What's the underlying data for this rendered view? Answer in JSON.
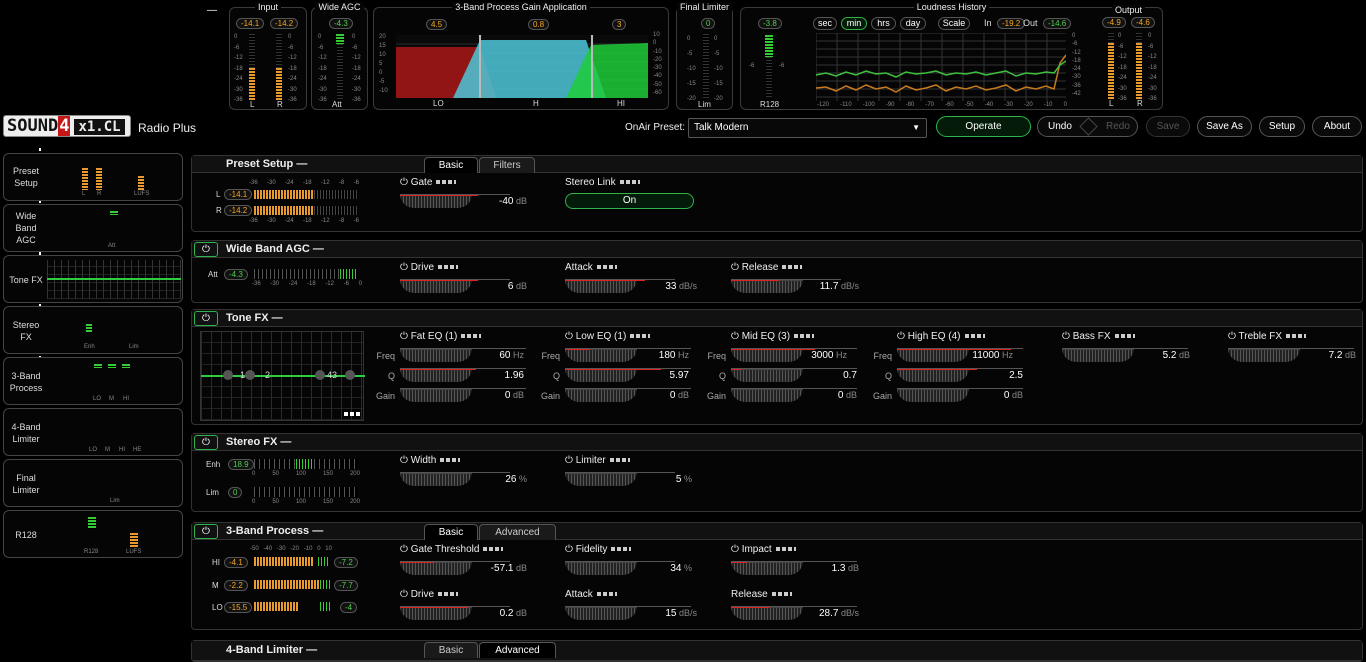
{
  "top": {
    "dash": "—",
    "input": {
      "title": "Input",
      "l": "-14.1",
      "r": "-14.2",
      "ticks": [
        "0",
        "-6",
        "-12",
        "-18",
        "-24",
        "-30",
        "-36"
      ],
      "l_label": "L",
      "r_label": "R"
    },
    "agc": {
      "title": "Wide AGC",
      "val": "-4.3",
      "ticks": [
        "0",
        "-6",
        "-12",
        "-18",
        "-24",
        "-30",
        "-36"
      ],
      "label": "Att"
    },
    "band3": {
      "title": "3-Band Process Gain Application",
      "v1": "4.5",
      "v2": "0.8",
      "v3": "3",
      "lo": "LO",
      "mid": "H",
      "hi": "HI",
      "lticks": [
        "20",
        "15",
        "10",
        "5",
        "0",
        "-5",
        "-10"
      ],
      "rticks": [
        "10",
        "0",
        "-10",
        "-20",
        "-30",
        "-40",
        "-50",
        "-60"
      ]
    },
    "final": {
      "title": "Final Limiter",
      "val": "0",
      "ticks": [
        "0",
        "-5",
        "-10",
        "-15",
        "-20"
      ],
      "label": "Lim"
    },
    "loudness": {
      "title": "Loudness History",
      "val": "-3.8",
      "btns": [
        "sec",
        "min",
        "hrs",
        "day"
      ],
      "scale": "Scale",
      "in_label": "In",
      "in_val": "-19.2",
      "out_label": "Out",
      "out_val": "-14.6",
      "lticks": [
        "0",
        "-6",
        "-12"
      ],
      "rticks": [
        "0",
        "-6",
        "-12",
        "-18",
        "-24",
        "-30",
        "-36",
        "-42"
      ],
      "xticks": [
        "-120",
        "-110",
        "-100",
        "-90",
        "-80",
        "-70",
        "-60",
        "-50",
        "-40",
        "-30",
        "-20",
        "-10",
        "0"
      ],
      "label": "R128",
      "left_top": "-6"
    },
    "output": {
      "title": "Output",
      "l": "-4.9",
      "r": "-4.6",
      "ticks": [
        "0",
        "-6",
        "-12",
        "-18",
        "-24",
        "-30",
        "-36"
      ],
      "l_label": "L",
      "r_label": "R"
    }
  },
  "brand": {
    "logo1": "SOUND",
    "logo2": "4",
    "logo3": "x1.CL",
    "product": "Radio Plus"
  },
  "toolbar": {
    "onair_label": "OnAir Preset:",
    "preset": "Talk Modern",
    "operate": "Operate",
    "undo": "Undo",
    "redo": "Redo",
    "save": "Save",
    "save_as": "Save As",
    "setup": "Setup",
    "about": "About"
  },
  "sidebar": [
    {
      "label": "Preset Setup",
      "sub": [
        "L",
        "R",
        "LUFS"
      ]
    },
    {
      "label": "Wide Band AGC",
      "sub": [
        "Att"
      ]
    },
    {
      "label": "Tone FX",
      "sub": []
    },
    {
      "label": "Stereo FX",
      "sub": [
        "Enh",
        "Lim"
      ]
    },
    {
      "label": "3-Band Process",
      "sub": [
        "LO",
        "M",
        "HI"
      ]
    },
    {
      "label": "4-Band Limiter",
      "sub": [
        "LO",
        "M",
        "HI",
        "HE"
      ]
    },
    {
      "label": "Final Limiter",
      "sub": [
        "Lim"
      ]
    },
    {
      "label": "R128",
      "sub": [
        "R128",
        "LUFS"
      ]
    }
  ],
  "preset_setup": {
    "title": "Preset Setup",
    "dash": "—",
    "tab1": "Basic",
    "tab2": "Filters",
    "l_val": "-14.1",
    "r_val": "-14.2",
    "l": "L",
    "r": "R",
    "scale": [
      "-36",
      "-30",
      "-24",
      "-18",
      "-12",
      "-8",
      "-6"
    ],
    "gate": {
      "name": "Gate",
      "value": "-40",
      "unit": "dB"
    },
    "stereo_link": {
      "name": "Stereo Link",
      "value": "On"
    }
  },
  "wideband": {
    "title": "Wide Band AGC",
    "dash": "—",
    "att_label": "Att",
    "att_val": "-4.3",
    "scale": [
      "-36",
      "-30",
      "-24",
      "-18",
      "-12",
      "-6",
      "0"
    ],
    "params": [
      {
        "name": "Drive",
        "value": "6",
        "unit": "dB"
      },
      {
        "name": "Attack",
        "value": "33",
        "unit": "dB/s"
      },
      {
        "name": "Release",
        "value": "11.7",
        "unit": "dB/s"
      }
    ]
  },
  "tonefx": {
    "title": "Tone FX",
    "dash": "—",
    "points": [
      "1",
      "2",
      "43"
    ],
    "eqs": [
      {
        "name": "Fat EQ (1)",
        "freq": "60",
        "q": "1.96",
        "gain": "0"
      },
      {
        "name": "Low EQ (1)",
        "freq": "180",
        "q": "5.97",
        "gain": "0"
      },
      {
        "name": "Mid EQ (3)",
        "freq": "3000",
        "q": "0.7",
        "gain": "0"
      },
      {
        "name": "High EQ (4)",
        "freq": "11000",
        "q": "2.5",
        "gain": "0"
      }
    ],
    "freq_label": "Freq",
    "q_label": "Q",
    "gain_label": "Gain",
    "hz": "Hz",
    "db": "dB",
    "bass": {
      "name": "Bass FX",
      "value": "5.2",
      "unit": "dB"
    },
    "treble": {
      "name": "Treble FX",
      "value": "7.2",
      "unit": "dB"
    }
  },
  "stereofx": {
    "title": "Stereo FX",
    "dash": "—",
    "enh_label": "Enh",
    "enh_val": "18.9",
    "lim_label": "Lim",
    "lim_val": "0",
    "scale": [
      "0",
      "50",
      "100",
      "150",
      "200"
    ],
    "width": {
      "name": "Width",
      "value": "26",
      "unit": "%"
    },
    "limiter": {
      "name": "Limiter",
      "value": "5",
      "unit": "%"
    }
  },
  "process3": {
    "title": "3-Band Process",
    "dash": "—",
    "tab1": "Basic",
    "tab2": "Advanced",
    "bands": [
      {
        "label": "HI",
        "left": "-4.1",
        "right": "-7.2"
      },
      {
        "label": "M",
        "left": "-2.2",
        "right": "-7.7"
      },
      {
        "label": "LO",
        "left": "-15.5",
        "right": "-4"
      }
    ],
    "scale": [
      "-50",
      "-40",
      "-30",
      "-20",
      "-10",
      "0",
      "10"
    ],
    "params": [
      {
        "name": "Gate Threshold",
        "value": "-57.1",
        "unit": "dB"
      },
      {
        "name": "Fidelity",
        "value": "34",
        "unit": "%"
      },
      {
        "name": "Impact",
        "value": "1.3",
        "unit": "dB"
      },
      {
        "name": "Drive",
        "value": "0.2",
        "unit": "dB"
      },
      {
        "name": "Attack",
        "value": "15",
        "unit": "dB/s"
      },
      {
        "name": "Release",
        "value": "28.7",
        "unit": "dB/s"
      }
    ]
  },
  "limiter4": {
    "title": "4-Band Limiter",
    "dash": "—",
    "tab1": "Basic",
    "tab2": "Advanced"
  }
}
